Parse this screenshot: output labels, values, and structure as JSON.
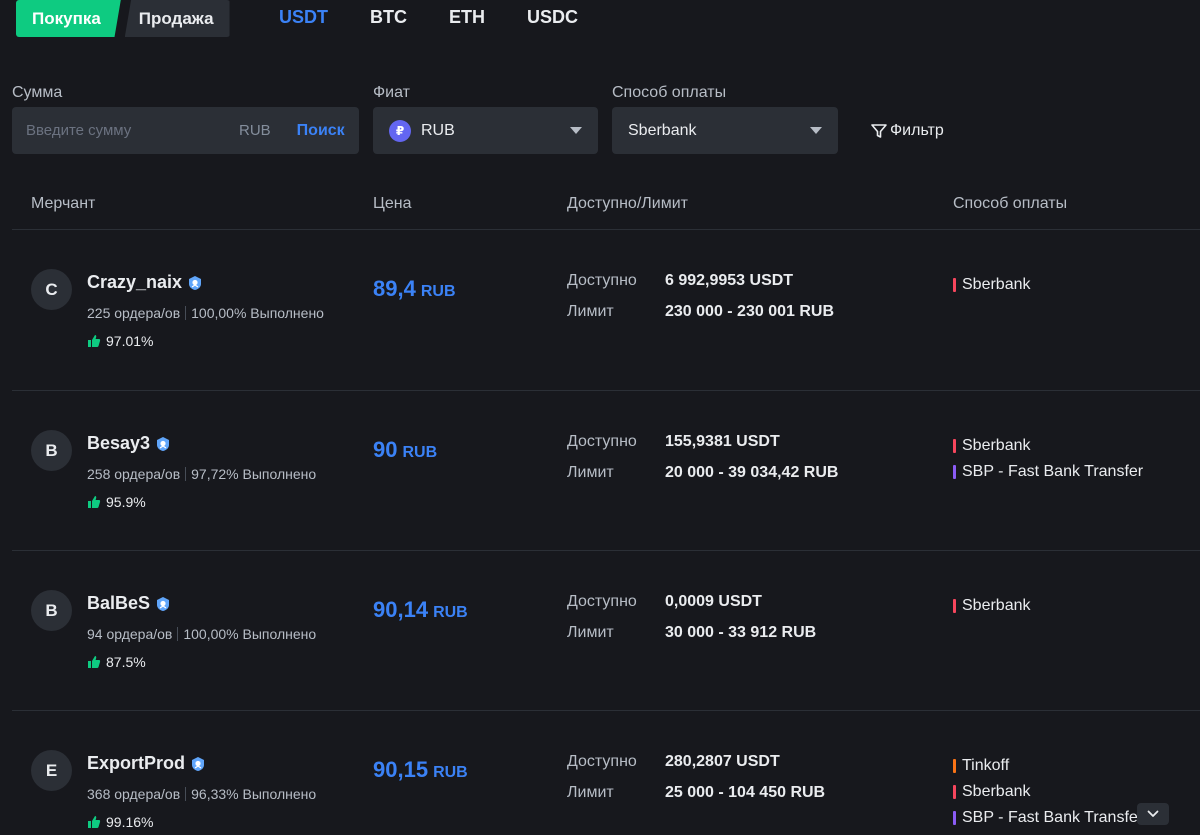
{
  "trade": {
    "buy": "Покупка",
    "sell": "Продажа"
  },
  "assets": [
    "USDT",
    "BTC",
    "ETH",
    "USDC"
  ],
  "filters": {
    "amount_label": "Сумма",
    "amount_placeholder": "Введите сумму",
    "amount_unit": "RUB",
    "search": "Поиск",
    "fiat_label": "Фиат",
    "fiat_value": "RUB",
    "fiat_symbol": "₽",
    "payment_label": "Способ оплаты",
    "payment_value": "Sberbank",
    "filter_button": "Фильтр"
  },
  "table": {
    "headers": {
      "merchant": "Мерчант",
      "price": "Цена",
      "available_limit": "Доступно/Лимит",
      "payment": "Способ оплаты"
    },
    "available_label": "Доступно",
    "limit_label": "Лимит",
    "rows": [
      {
        "initial": "C",
        "name": "Crazy_naix",
        "orders": "225 ордера/ов",
        "completion": "100,00% Выполнено",
        "rating": "97.01%",
        "price": "89,4",
        "currency": "RUB",
        "available": "6 992,9953 USDT",
        "limit": "230 000 - 230 001 RUB",
        "methods": [
          {
            "name": "Sberbank",
            "color": "#f6465d"
          }
        ]
      },
      {
        "initial": "B",
        "name": "Besay3",
        "orders": "258 ордера/ов",
        "completion": "97,72% Выполнено",
        "rating": "95.9%",
        "price": "90",
        "currency": "RUB",
        "available": "155,9381 USDT",
        "limit": "20 000 - 39 034,42 RUB",
        "methods": [
          {
            "name": "Sberbank",
            "color": "#f6465d"
          },
          {
            "name": "SBP - Fast Bank Transfer",
            "color": "#8b5cf6"
          }
        ]
      },
      {
        "initial": "B",
        "name": "BalBeS",
        "orders": "94 ордера/ов",
        "completion": "100,00% Выполнено",
        "rating": "87.5%",
        "price": "90,14",
        "currency": "RUB",
        "available": "0,0009 USDT",
        "limit": "30 000 - 33 912 RUB",
        "methods": [
          {
            "name": "Sberbank",
            "color": "#f6465d"
          }
        ]
      },
      {
        "initial": "E",
        "name": "ExportProd",
        "orders": "368 ордера/ов",
        "completion": "96,33% Выполнено",
        "rating": "99.16%",
        "price": "90,15",
        "currency": "RUB",
        "available": "280,2807 USDT",
        "limit": "25 000 - 104 450 RUB",
        "methods": [
          {
            "name": "Tinkoff",
            "color": "#f97316"
          },
          {
            "name": "Sberbank",
            "color": "#f6465d"
          },
          {
            "name": "SBP - Fast Bank Transfer",
            "color": "#8b5cf6"
          }
        ]
      }
    ]
  },
  "colors": {
    "buy": "#0ecb81",
    "accent": "#3b82f6",
    "background": "#17181d",
    "surface": "#2b2f36"
  }
}
